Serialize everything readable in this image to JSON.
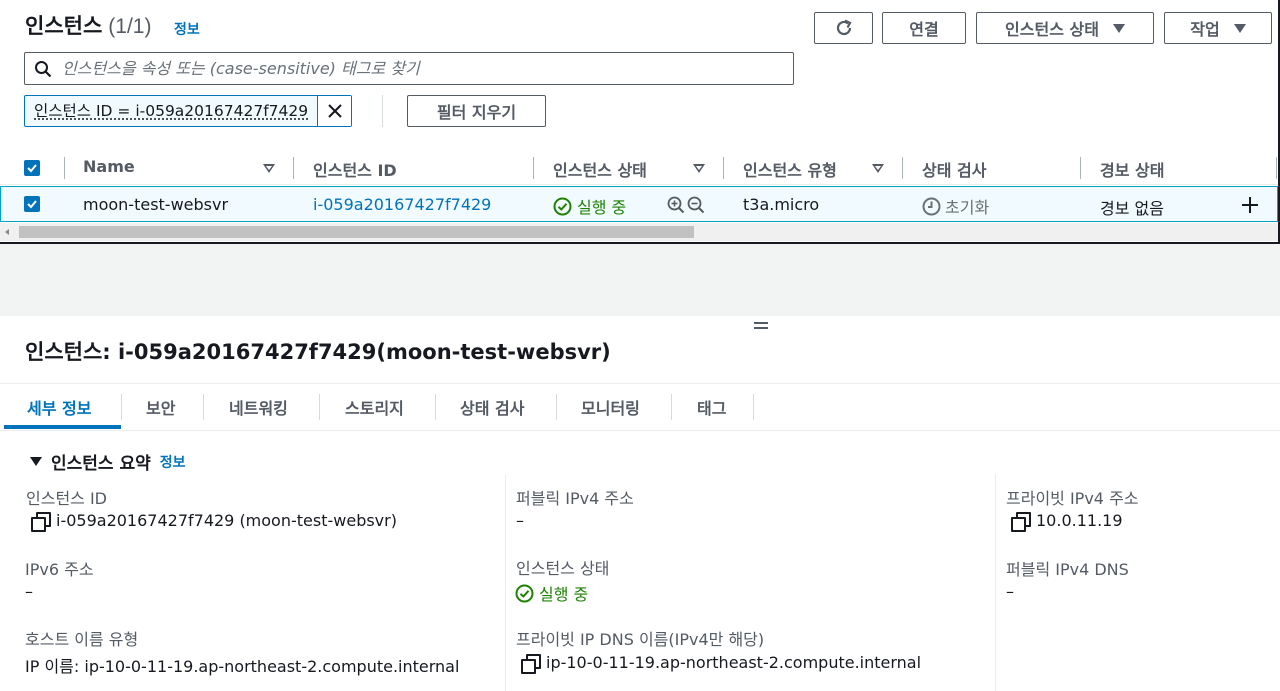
{
  "header": {
    "title": "인스턴스",
    "count": "(1/1)",
    "info": "정보",
    "refresh_icon": "refresh-icon",
    "connect_label": "연결",
    "instance_state_label": "인스턴스 상태",
    "actions_label": "작업"
  },
  "search": {
    "placeholder": "인스턴스을 속성 또는 (case-sensitive) 태그로 찾기"
  },
  "filter": {
    "token": "인스턴스 ID = i-059a20167427f7429",
    "clear_label": "필터 지우기"
  },
  "table": {
    "columns": [
      "Name",
      "인스턴스 ID",
      "인스턴스 상태",
      "인스턴스 유형",
      "상태 검사",
      "경보 상태"
    ],
    "rows": [
      {
        "name": "moon-test-websvr",
        "instance_id": "i-059a20167427f7429",
        "state": "실행 중",
        "type": "t3a.micro",
        "status_check": "초기화",
        "alarm": "경보 없음"
      }
    ]
  },
  "detail": {
    "title": "인스턴스: i-059a20167427f7429(moon-test-websvr)",
    "tabs": [
      "세부 정보",
      "보안",
      "네트워킹",
      "스토리지",
      "상태 검사",
      "모니터링",
      "태그"
    ],
    "section_title": "인스턴스 요약",
    "section_info": "정보",
    "fields": {
      "instance_id_label": "인스턴스 ID",
      "instance_id_value": "i-059a20167427f7429 (moon-test-websvr)",
      "public_ipv4_label": "퍼블릭 IPv4 주소",
      "public_ipv4_value": "–",
      "private_ipv4_label": "프라이빗 IPv4 주소",
      "private_ipv4_value": "10.0.11.19",
      "ipv6_label": "IPv6 주소",
      "ipv6_value": "–",
      "instance_state_label": "인스턴스 상태",
      "instance_state_value": "실행 중",
      "public_dns_label": "퍼블릭 IPv4 DNS",
      "public_dns_value": "–",
      "hostname_type_label": "호스트 이름 유형",
      "hostname_type_value": "IP 이름: ip-10-0-11-19.ap-northeast-2.compute.internal",
      "private_dns_label": "프라이빗 IP DNS 이름(IPv4만 해당)",
      "private_dns_value": "ip-10-0-11-19.ap-northeast-2.compute.internal"
    }
  },
  "colors": {
    "accent": "#0073bb",
    "success": "#1d8102",
    "text": "#16191f",
    "muted": "#545b64"
  }
}
